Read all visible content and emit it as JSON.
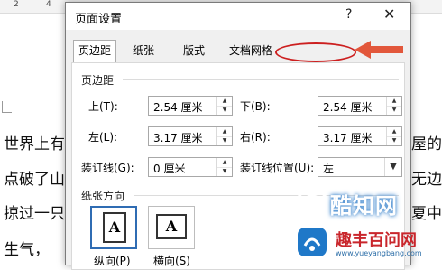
{
  "background_document": {
    "ruler_marks": [
      "2",
      "4"
    ],
    "lines": [
      "世界上有",
      "屋的",
      "点破了山",
      "无边",
      "掠过一只",
      "夏中",
      "生气，"
    ]
  },
  "dialog": {
    "title": "页面设置",
    "help_label": "?",
    "close_label": "✕",
    "tabs": [
      {
        "label": "页边距",
        "active": true
      },
      {
        "label": "纸张",
        "active": false
      },
      {
        "label": "版式",
        "active": false
      },
      {
        "label": "文档网格",
        "active": false,
        "highlighted": true
      }
    ],
    "annotation_color": "#cc1f1f",
    "arrow_color": "#e2573b",
    "margins": {
      "section_label": "页边距",
      "top_label": "上(T):",
      "top_value": "2.54 厘米",
      "bottom_label": "下(B):",
      "bottom_value": "2.54 厘米",
      "left_label": "左(L):",
      "left_value": "3.17 厘米",
      "right_label": "右(R):",
      "right_value": "3.17 厘米",
      "gutter_label": "装订线(G):",
      "gutter_value": "0 厘米",
      "gutter_pos_label": "装订线位置(U):",
      "gutter_pos_value": "左"
    },
    "orientation": {
      "section_label": "纸张方向",
      "portrait_label": "纵向(P)",
      "landscape_label": "横向(S)",
      "portrait_glyph": "A",
      "landscape_glyph": "A",
      "selected": "portrait"
    }
  },
  "watermark": {
    "brand": "酷知网",
    "cn_text": "趣丰百问网",
    "url": "www.yueyangbang.com"
  }
}
